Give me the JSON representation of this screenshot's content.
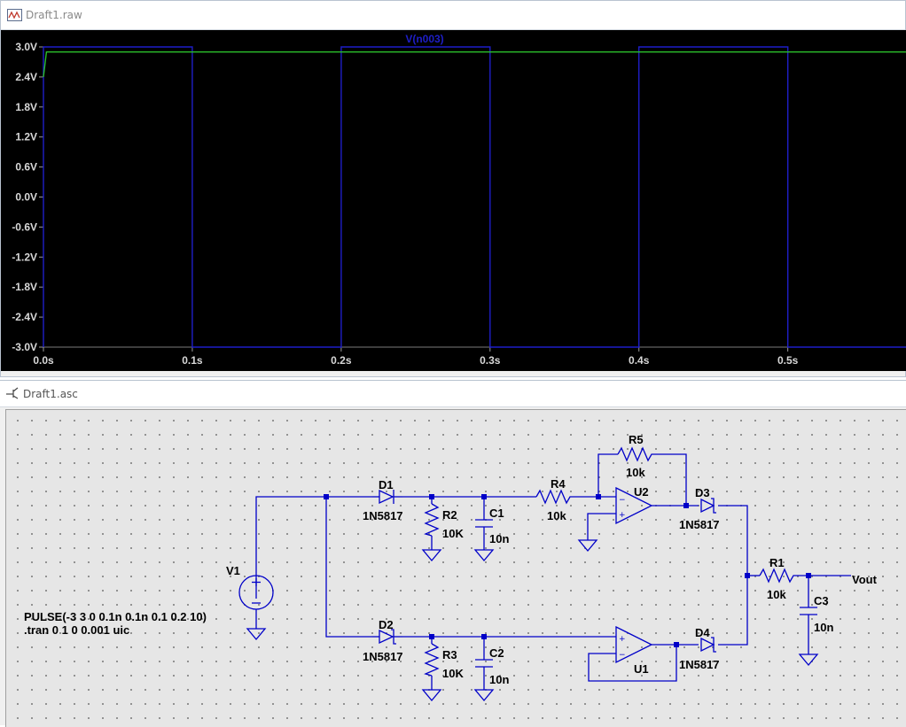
{
  "waveform_window": {
    "title": "Draft1.raw",
    "trace_label": "V(n003)",
    "colors": {
      "background": "#000000",
      "trace": "#1e1ec8",
      "secondary_trace": "#2bbf2b",
      "axis_text": "#d8d8d8"
    },
    "chart_data": {
      "type": "line",
      "title": "V(n003)",
      "xlabel": "",
      "ylabel": "",
      "xlim": [
        0,
        0.58
      ],
      "ylim": [
        -3.0,
        3.0
      ],
      "y_ticks": [
        "3.0V",
        "2.4V",
        "1.8V",
        "1.2V",
        "0.6V",
        "0.0V",
        "-0.6V",
        "-1.2V",
        "-1.8V",
        "-2.4V",
        "-3.0V"
      ],
      "x_ticks": [
        "0.0s",
        "0.1s",
        "0.2s",
        "0.3s",
        "0.4s",
        "0.5s"
      ],
      "series": [
        {
          "name": "V(n003)",
          "x": [
            0,
            0,
            0.1,
            0.1,
            0.2,
            0.2,
            0.3,
            0.3,
            0.4,
            0.4,
            0.5,
            0.5,
            0.58
          ],
          "y": [
            -3.0,
            3.0,
            3.0,
            -3.0,
            -3.0,
            3.0,
            3.0,
            -3.0,
            -3.0,
            3.0,
            3.0,
            -3.0,
            -3.0
          ]
        },
        {
          "x": [
            0.0,
            0.002,
            0.58
          ],
          "y": [
            2.4,
            2.9,
            2.9
          ]
        }
      ]
    }
  },
  "schematic_window": {
    "title": "Draft1.asc",
    "directives": {
      "pulse": "PULSE(-3 3 0 0.1n 0.1n 0.1 0.2 10)",
      "tran": ".tran 0 1 0 0.001 uic"
    },
    "components": {
      "V1": {
        "ref": "V1"
      },
      "D1": {
        "ref": "D1",
        "value": "1N5817"
      },
      "D2": {
        "ref": "D2",
        "value": "1N5817"
      },
      "D3": {
        "ref": "D3",
        "value": "1N5817"
      },
      "D4": {
        "ref": "D4",
        "value": "1N5817"
      },
      "R1": {
        "ref": "R1",
        "value": "10k"
      },
      "R2": {
        "ref": "R2",
        "value": "10K"
      },
      "R3": {
        "ref": "R3",
        "value": "10K"
      },
      "R4": {
        "ref": "R4",
        "value": "10k"
      },
      "R5": {
        "ref": "R5",
        "value": "10k"
      },
      "C1": {
        "ref": "C1",
        "value": "10n"
      },
      "C2": {
        "ref": "C2",
        "value": "10n"
      },
      "C3": {
        "ref": "C3",
        "value": "10n"
      },
      "U1": {
        "ref": "U1"
      },
      "U2": {
        "ref": "U2"
      }
    },
    "net_label": "Vout",
    "colors": {
      "wire": "#0000c8",
      "grid_bg": "#e6e6e6"
    }
  }
}
